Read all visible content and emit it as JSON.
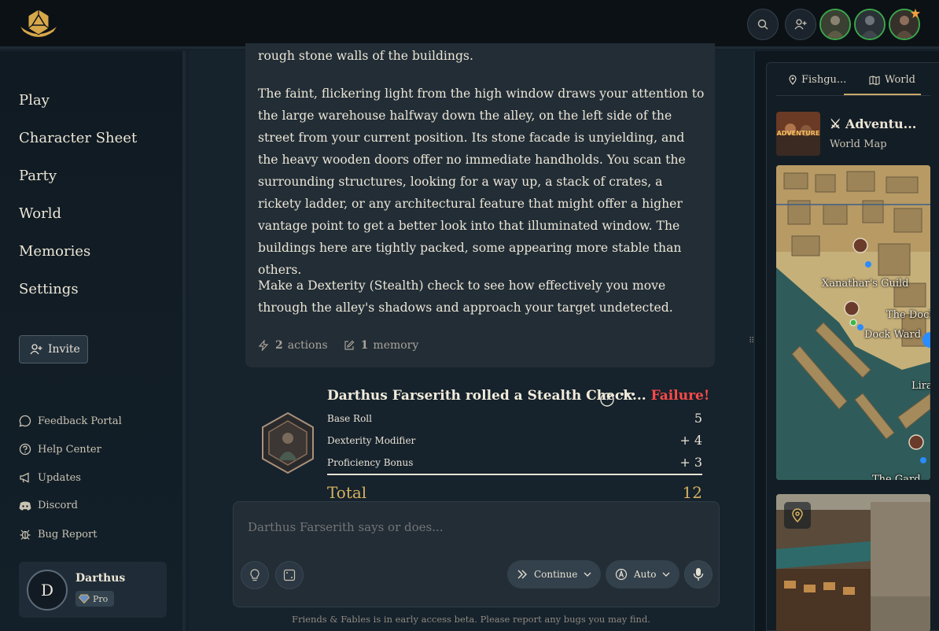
{
  "topbar": {
    "search_icon": "search-icon",
    "add_friend_icon": "user-plus-icon",
    "accent": "#3ba84a"
  },
  "sidebar": {
    "nav": [
      {
        "label": "Play"
      },
      {
        "label": "Character Sheet"
      },
      {
        "label": "Party"
      },
      {
        "label": "World"
      },
      {
        "label": "Memories"
      },
      {
        "label": "Settings"
      }
    ],
    "invite_label": "Invite",
    "links": [
      {
        "label": "Feedback Portal",
        "icon": "chat-bubble-icon"
      },
      {
        "label": "Help Center",
        "icon": "help-circle-icon"
      },
      {
        "label": "Updates",
        "icon": "megaphone-icon"
      },
      {
        "label": "Discord",
        "icon": "discord-icon"
      },
      {
        "label": "Bug Report",
        "icon": "bug-icon"
      }
    ],
    "user": {
      "initial": "D",
      "name": "Darthus",
      "tier": "Pro"
    }
  },
  "story": {
    "p1": "rough stone walls of the buildings.",
    "p2": "The faint, flickering light from the high window draws your attention to the large warehouse halfway down the alley, on the left side of the street from your current position. Its stone facade is unyielding, and the heavy wooden doors offer no immediate handholds. You scan the surrounding structures, looking for a way up, a stack of crates, a rickety ladder, or any architectural feature that might offer a higher vantage point to get a better look into that illuminated window. The buildings here are tightly packed, some appearing more stable than others.",
    "p3": "Make a Dexterity (Stealth) check to see how effectively you move through the alley's shadows and approach your target undetected.",
    "actions_count": "2",
    "actions_label": "actions",
    "memory_count": "1",
    "memory_label": "memory"
  },
  "roll": {
    "title": "Darthus Farserith rolled a Stealth Check...",
    "result": "Failure!",
    "rows": [
      {
        "label": "Base Roll",
        "value": "5"
      },
      {
        "label": "Dexterity Modifier",
        "value": "+ 4"
      },
      {
        "label": "Proficiency Bonus",
        "value": "+ 3"
      }
    ],
    "total_label": "Total",
    "total_value": "12",
    "fail_color": "#ff4a47"
  },
  "composer": {
    "placeholder": "Darthus Farserith says or does...",
    "continue_label": "Continue",
    "auto_label": "Auto"
  },
  "footer": "Friends & Fables is in early access beta. Please report any bugs you may find.",
  "rightpanel": {
    "tab_location": "Fishgu...",
    "tab_world": "World",
    "adventure_title": "⚔ Adventu...",
    "adventure_sub": "World Map",
    "thumb_text": "ADVENTURE",
    "map_labels": {
      "xanathar": "Xanathar's Guild",
      "docks": "The Dock",
      "dock_ward": "Dock Ward",
      "lira": "Lira",
      "bottom": "The Gard..."
    }
  }
}
